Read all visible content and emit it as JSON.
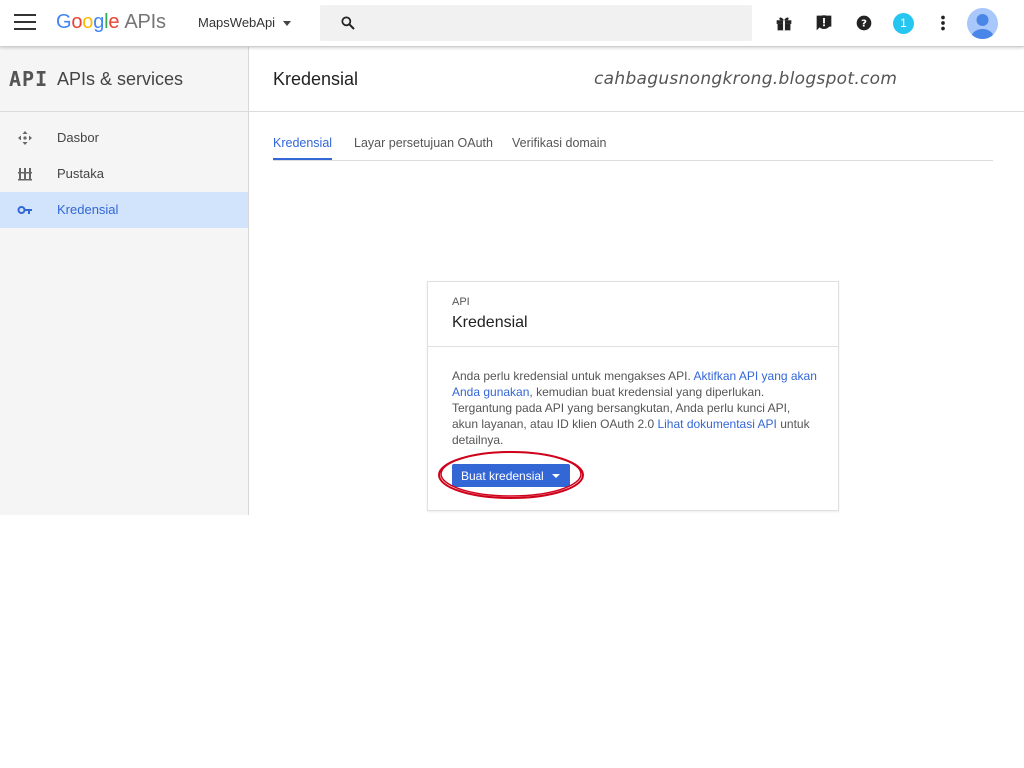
{
  "topbar": {
    "logo_word": [
      "G",
      "o",
      "o",
      "g",
      "l",
      "e"
    ],
    "logo_apis": "APIs",
    "project_name": "MapsWebApi",
    "search_placeholder": "",
    "notification_count": "1"
  },
  "sidebar": {
    "mono": "API",
    "title": "APIs & services",
    "items": [
      {
        "label": "Dasbor",
        "icon": "dashboard-icon",
        "active": false
      },
      {
        "label": "Pustaka",
        "icon": "library-icon",
        "active": false
      },
      {
        "label": "Kredensial",
        "icon": "key-icon",
        "active": true
      }
    ]
  },
  "main": {
    "title": "Kredensial",
    "watermark": "cahbagusnongkrong.blogspot.com",
    "tabs": [
      {
        "label": "Kredensial",
        "active": true
      },
      {
        "label": "Layar persetujuan OAuth",
        "active": false
      },
      {
        "label": "Verifikasi domain",
        "active": false
      }
    ]
  },
  "card": {
    "eyebrow": "API",
    "title": "Kredensial",
    "body_1": "Anda perlu kredensial untuk mengakses API. ",
    "link_1": "Aktifkan API yang akan Anda gunakan",
    "body_2": ", kemudian buat kredensial yang diperlukan. Tergantung pada API yang bersangkutan, Anda perlu kunci API, akun layanan, atau ID klien OAuth 2.0 ",
    "link_2": "Lihat dokumentasi API",
    "body_3": " untuk detailnya.",
    "button_label": "Buat kredensial"
  },
  "colors": {
    "accent": "#3367d6",
    "active_nav_bg": "#d2e3fc",
    "highlight_ring": "#d0021b",
    "badge": "#26c6f0"
  }
}
